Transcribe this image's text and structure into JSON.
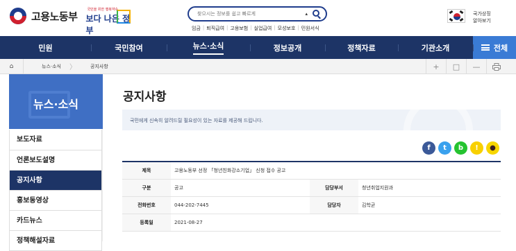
{
  "header": {
    "logo_text": "고용노동부",
    "slogan_small": "국민을 위한 행복약속",
    "slogan_big": "보다 나은 정부",
    "search_placeholder": "찾으시는 정보를 쉽고 빠르게",
    "quick_links": [
      "임금",
      "퇴직급여",
      "고용보험",
      "실업급여",
      "모성보호",
      "민원서식"
    ],
    "national_symbol_label": [
      "국가상징",
      "알아보기"
    ]
  },
  "gnb": {
    "items": [
      "민원",
      "국민참여",
      "뉴스·소식",
      "정보공개",
      "정책자료",
      "기관소개"
    ],
    "active_index": 2,
    "all_label": "전체"
  },
  "breadcrumb": {
    "home_icon": "home-icon",
    "items": [
      "뉴스·소식",
      "공지사항"
    ],
    "tools": [
      "+",
      "□",
      "—",
      "print-icon"
    ]
  },
  "lnb": {
    "title": "뉴스·소식",
    "items": [
      "보도자료",
      "언론보도설명",
      "공지사항",
      "홍보동영상",
      "카드뉴스",
      "정책해설자료"
    ],
    "active_index": 2
  },
  "content": {
    "title": "공지사항",
    "intro": "국민에게 신속히 알려드릴 필요성이 있는 자료를 제공해 드립니다.",
    "share_icons": [
      "facebook-icon",
      "twitter-icon",
      "band-icon",
      "kakaostory-icon",
      "kakaotalk-icon"
    ],
    "share_colors": [
      "#3b5998",
      "#3aa1ee",
      "#25c330",
      "#f8d000",
      "#f7d600"
    ],
    "table": {
      "subject_label": "제목",
      "subject_value": "고용노동부 선정 「청년친화강소기업」 신청 접수 공고",
      "type_label": "구분",
      "type_value": "공고",
      "dept_label": "담당부서",
      "dept_value": "청년취업지원과",
      "phone_label": "전화번호",
      "phone_value": "044-202-7445",
      "manager_label": "담당자",
      "manager_value": "김학균",
      "date_label": "등록일",
      "date_value": "2021-08-27"
    }
  }
}
